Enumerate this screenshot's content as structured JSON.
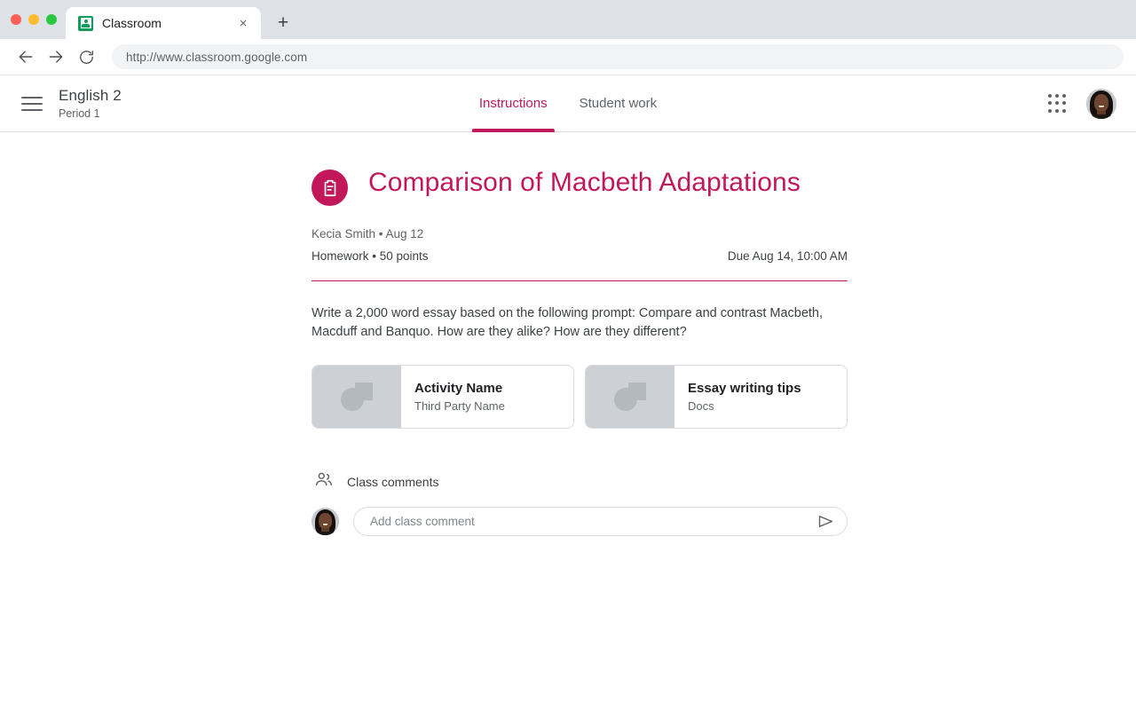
{
  "browser": {
    "tab": {
      "title": "Classroom",
      "favicon": "classroom-favicon",
      "close_label": "×"
    },
    "new_tab_label": "+",
    "back_label": "←",
    "forward_label": "→",
    "reload_label": "↻",
    "url": "http://www.classroom.google.com"
  },
  "app_header": {
    "menu_icon": "hamburger-menu-icon",
    "course_name": "English 2",
    "course_section": "Period 1",
    "tabs": [
      {
        "label": "Instructions",
        "active": true
      },
      {
        "label": "Student work",
        "active": false
      }
    ],
    "apps_icon": "apps-grid-icon",
    "avatar": "user-avatar"
  },
  "assignment": {
    "icon": "assignment-clipboard-icon",
    "title": "Comparison of Macbeth Adaptations",
    "author": "Kecia Smith",
    "separator": "•",
    "posted_date": "Aug 12",
    "meta_author_line": "Kecia Smith  • Aug 12",
    "category": "Homework",
    "points": "50 points",
    "meta_category_line": "Homework • 50 points",
    "due": "Due Aug 14, 10:00 AM",
    "description": "Write a 2,000 word essay based on the following prompt: Compare and contrast Macbeth, Macduff and Banquo. How are they alike? How are they different?",
    "attachments": [
      {
        "title": "Activity Name",
        "subtitle": "Third Party Name",
        "thumbnail_icon": "image-placeholder-icon"
      },
      {
        "title": "Essay writing tips",
        "subtitle": "Docs",
        "thumbnail_icon": "image-placeholder-icon"
      }
    ]
  },
  "comments": {
    "icon": "people-icon",
    "heading": "Class comments",
    "avatar": "user-avatar",
    "input_placeholder": "Add class comment",
    "input_value": "",
    "send_icon": "send-icon"
  },
  "colors": {
    "accent": "#c2185b",
    "chrome_bg": "#dee1e6",
    "text_primary": "#3c4043",
    "text_secondary": "#5f6368",
    "border": "#dadce0",
    "thumb_bg": "#cdd0d4"
  }
}
